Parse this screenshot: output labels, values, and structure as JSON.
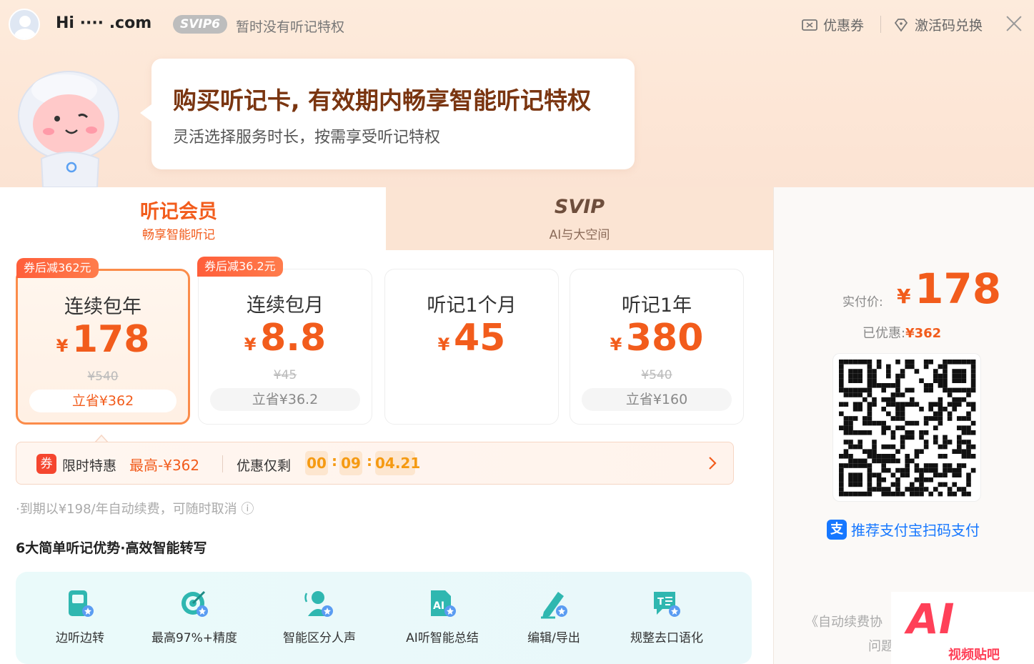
{
  "header": {
    "username": "Hi ···· .com",
    "svip_level": "SVIP6",
    "no_privilege": "暂时没有听记特权",
    "coupon_label": "优惠券",
    "activation_label": "激活码兑换"
  },
  "banner": {
    "title": "购买听记卡, 有效期内畅享智能听记特权",
    "subtitle": "灵活选择服务时长，按需享受听记特权"
  },
  "tabs": [
    {
      "title": "听记会员",
      "subtitle": "畅享智能听记"
    },
    {
      "title": "SVIP",
      "subtitle": "AI与大空间"
    }
  ],
  "plans": [
    {
      "badge": "券后减362元",
      "name": "连续包年",
      "currency": "¥",
      "price": "178",
      "original": "¥540",
      "save": "立省¥362"
    },
    {
      "badge": "券后减36.2元",
      "name": "连续包月",
      "currency": "¥",
      "price": "8.8",
      "original": "¥45",
      "save": "立省¥36.2"
    },
    {
      "badge": "",
      "name": "听记1个月",
      "currency": "¥",
      "price": "45",
      "original": "",
      "save": ""
    },
    {
      "badge": "",
      "name": "听记1年",
      "currency": "¥",
      "price": "380",
      "original": "¥540",
      "save": "立省¥160"
    }
  ],
  "promo": {
    "icon_text": "券",
    "label": "限时特惠",
    "max_discount": "最高-¥362",
    "only_left": "优惠仅剩",
    "countdown": [
      "00",
      "09",
      "04.21"
    ]
  },
  "renew_note": "·到期以¥198/年自动续费，可随时取消 ⓘ",
  "features_title": "6大简单听记优势·高效智能转写",
  "features": [
    {
      "label": "边听边转",
      "icon": "phone-transcribe-icon"
    },
    {
      "label": "最高97%+精度",
      "icon": "target-icon"
    },
    {
      "label": "智能区分人声",
      "icon": "speaker-icon"
    },
    {
      "label": "AI听智能总结",
      "icon": "ai-doc-icon"
    },
    {
      "label": "编辑/导出",
      "icon": "edit-export-icon"
    },
    {
      "label": "规整去口语化",
      "icon": "text-clean-icon"
    }
  ],
  "payment": {
    "label": "实付价:",
    "currency": "¥",
    "amount": "178",
    "saved_label": "已优惠:",
    "saved_amount": "¥362",
    "alipay_label": "推荐支付宝扫码支付",
    "alipay_icon": "支",
    "agreement": "《自动续费协",
    "agreement2": "问题"
  },
  "watermark": {
    "big": "AI",
    "small": "视频贴吧"
  },
  "colors": {
    "accent": "#f25c1c",
    "alipay": "#1677ff",
    "countdown": "#f59a12"
  }
}
